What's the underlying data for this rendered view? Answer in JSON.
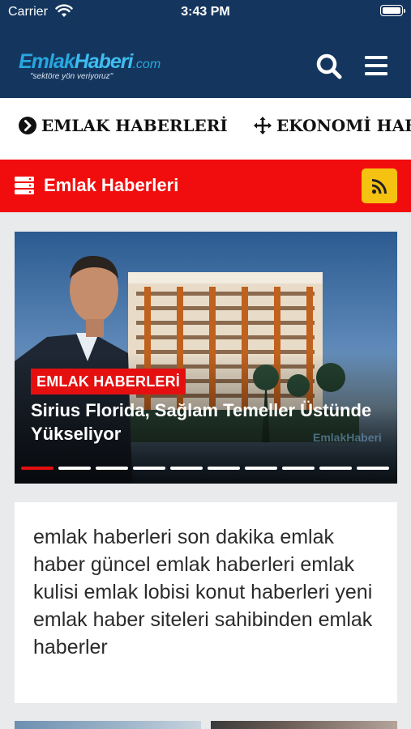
{
  "status_bar": {
    "carrier": "Carrier",
    "time": "3:43 PM"
  },
  "header": {
    "logo_part1": "Emlak",
    "logo_part2": "Haberi",
    "logo_domain": ".com",
    "slogan": "\"sektöre yön veriyoruz\""
  },
  "categories": [
    {
      "label": "EMLAK HABERLERİ",
      "icon": "chevron-circle-right-icon"
    },
    {
      "label": "EKONOMİ HABERLERİ",
      "icon": "move-arrows-icon"
    }
  ],
  "section": {
    "title": "Emlak Haberleri",
    "icon": "server-list-icon",
    "rss_icon": "rss-icon"
  },
  "slider": {
    "badge": "EMLAK HABERLERİ",
    "headline": "Sirius Florida, Sağlam Temeller Üstünde Yükseliyor",
    "watermark": "EmlakHaberi",
    "slide_count": 10,
    "active_slide": 1
  },
  "description": "emlak haberleri son dakika emlak haber güncel emlak haberleri emlak kulisi emlak lobisi konut haberleri yeni emlak haber siteleri sahibinden emlak haberler",
  "colors": {
    "header": "#14365e",
    "accent_red": "#f10d0d",
    "rss_yellow": "#f6c211",
    "logo_blue": "#27a7e0"
  }
}
